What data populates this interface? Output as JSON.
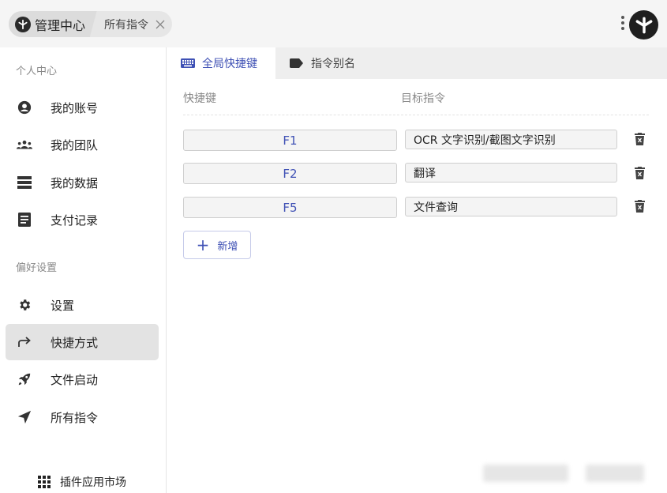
{
  "header": {
    "app_title": "管理中心",
    "tab_label": "所有指令"
  },
  "sidebar": {
    "section_personal": "个人中心",
    "section_prefs": "偏好设置",
    "items": [
      {
        "label": "我的账号",
        "icon": "account-icon"
      },
      {
        "label": "我的团队",
        "icon": "team-icon"
      },
      {
        "label": "我的数据",
        "icon": "data-icon"
      },
      {
        "label": "支付记录",
        "icon": "receipt-icon"
      },
      {
        "label": "设置",
        "icon": "gear-icon"
      },
      {
        "label": "快捷方式",
        "icon": "shortcut-arrow-icon",
        "active": true
      },
      {
        "label": "文件启动",
        "icon": "rocket-icon"
      },
      {
        "label": "所有指令",
        "icon": "send-icon"
      }
    ],
    "market_label": "插件应用市场"
  },
  "main": {
    "tabs": [
      {
        "label": "全局快捷键",
        "icon": "keyboard-icon",
        "active": true
      },
      {
        "label": "指令别名",
        "icon": "label-icon",
        "active": false
      }
    ],
    "columns": {
      "shortcut": "快捷键",
      "target": "目标指令"
    },
    "rows": [
      {
        "key": "F1",
        "command": "OCR 文字识别/截图文字识别"
      },
      {
        "key": "F2",
        "command": "翻译"
      },
      {
        "key": "F5",
        "command": "文件查询"
      }
    ],
    "add_label": "新增"
  },
  "colors": {
    "accent": "#3f51b5",
    "active_nav": "#e3e3e3",
    "tab_bar": "#eeeeee"
  }
}
